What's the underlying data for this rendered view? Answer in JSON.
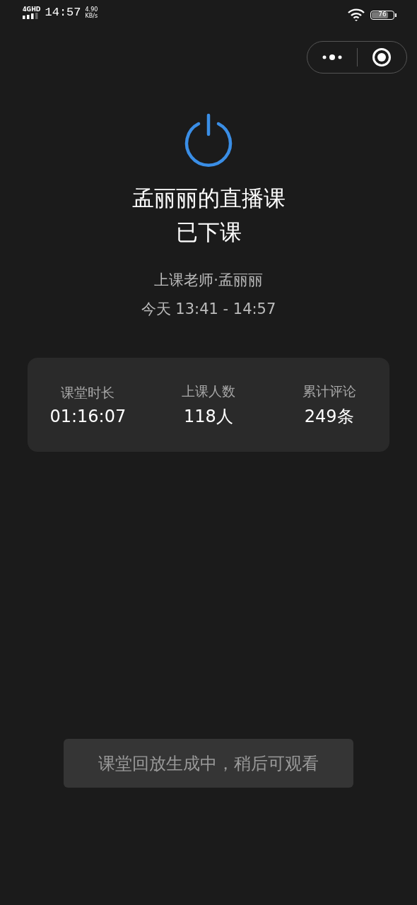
{
  "status_bar": {
    "network": "4G",
    "hd": "HD",
    "time": "14:57",
    "speed": "4.90",
    "speed_unit": "KB/s",
    "battery": {
      "level": 0.76,
      "text": "76"
    }
  },
  "title_lines": [
    "孟丽丽的直播课",
    "已下课"
  ],
  "teacher": "上课老师·孟丽丽",
  "time_range": "今天 13:41 - 14:57",
  "stats": [
    {
      "label": "课堂时长",
      "value": "01:16:07"
    },
    {
      "label": "上课人数",
      "value": "118人"
    },
    {
      "label": "累计评论",
      "value": "249条"
    }
  ],
  "toast": "课堂回放生成中，稍后可观看"
}
